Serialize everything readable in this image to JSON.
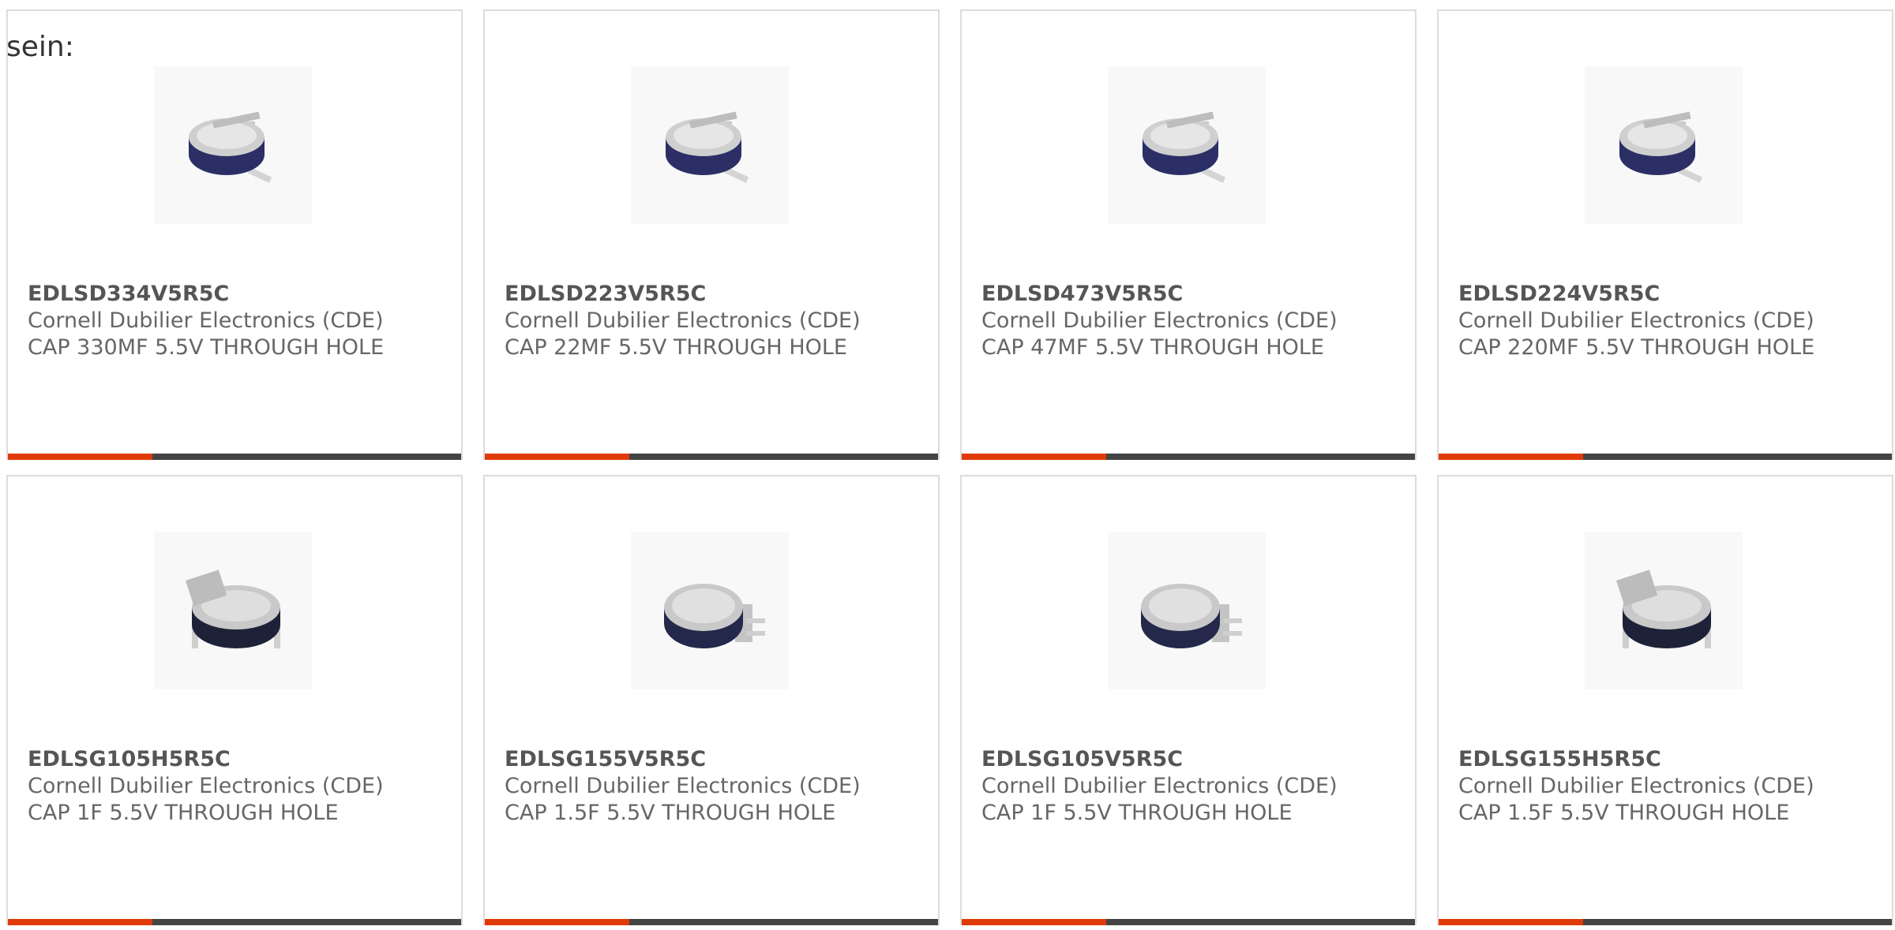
{
  "intro_text": "sein:",
  "colors": {
    "accent": "#e03a0a",
    "bar": "#444444",
    "card_border": "#dcdcdc",
    "title": "#555555",
    "text": "#666666"
  },
  "products": [
    {
      "part": "EDLSD334V5R5C",
      "manufacturer": "Cornell Dubilier Electronics (CDE)",
      "description": "CAP 330MF 5.5V THROUGH HOLE",
      "image": "coin-supercap-vertical"
    },
    {
      "part": "EDLSD223V5R5C",
      "manufacturer": "Cornell Dubilier Electronics (CDE)",
      "description": "CAP 22MF 5.5V THROUGH HOLE",
      "image": "coin-supercap-vertical"
    },
    {
      "part": "EDLSD473V5R5C",
      "manufacturer": "Cornell Dubilier Electronics (CDE)",
      "description": "CAP 47MF 5.5V THROUGH HOLE",
      "image": "coin-supercap-vertical"
    },
    {
      "part": "EDLSD224V5R5C",
      "manufacturer": "Cornell Dubilier Electronics (CDE)",
      "description": "CAP 220MF 5.5V THROUGH HOLE",
      "image": "coin-supercap-vertical"
    },
    {
      "part": "EDLSG105H5R5C",
      "manufacturer": "Cornell Dubilier Electronics (CDE)",
      "description": "CAP 1F 5.5V THROUGH HOLE",
      "image": "coin-supercap-horizontal"
    },
    {
      "part": "EDLSG155V5R5C",
      "manufacturer": "Cornell Dubilier Electronics (CDE)",
      "description": "CAP 1.5F 5.5V THROUGH HOLE",
      "image": "coin-supercap-vertical-large"
    },
    {
      "part": "EDLSG105V5R5C",
      "manufacturer": "Cornell Dubilier Electronics (CDE)",
      "description": "CAP 1F 5.5V THROUGH HOLE",
      "image": "coin-supercap-vertical-large"
    },
    {
      "part": "EDLSG155H5R5C",
      "manufacturer": "Cornell Dubilier Electronics (CDE)",
      "description": "CAP 1.5F 5.5V THROUGH HOLE",
      "image": "coin-supercap-horizontal"
    }
  ]
}
